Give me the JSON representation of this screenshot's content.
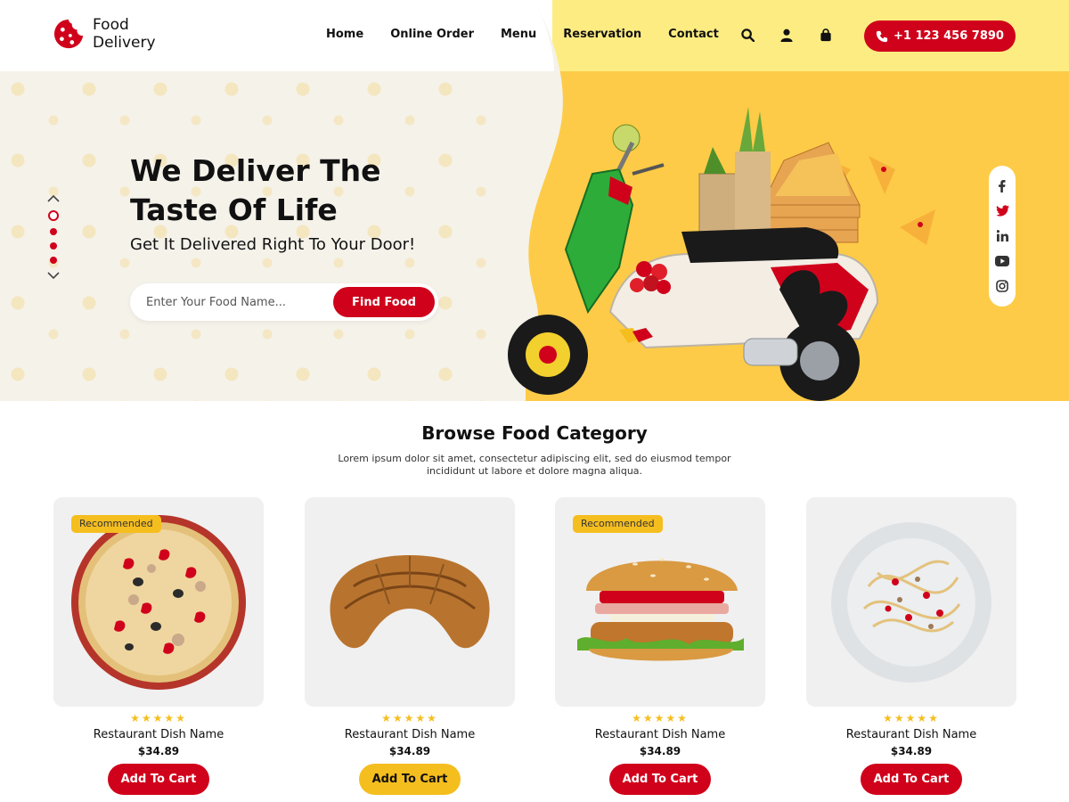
{
  "brand": {
    "line1": "Food",
    "line2": "Delivery",
    "accent": "#d0021b"
  },
  "nav": {
    "items": [
      "Home",
      "Online Order",
      "Menu",
      "Reservation",
      "Contact"
    ]
  },
  "header_icons": [
    "search-icon",
    "user-icon",
    "shopping-bag-icon"
  ],
  "phone": {
    "label": "+1 123 456 7890"
  },
  "hero": {
    "title_line1": "We Deliver The",
    "title_line2": "Taste Of Life",
    "subtitle": "Get It Delivered Right To Your Door!",
    "search_placeholder": "Enter Your Food Name...",
    "find_button": "Find Food",
    "slides": 4,
    "active_slide": 1
  },
  "social": [
    "facebook-icon",
    "twitter-icon",
    "linkedin-icon",
    "youtube-icon",
    "instagram-icon"
  ],
  "category": {
    "title": "Browse Food Category",
    "description": "Lorem ipsum dolor sit amet, consectetur adipiscing elit, sed do eiusmod tempor incididunt ut labore et dolore magna aliqua.",
    "cards": [
      {
        "food": "pizza",
        "badge": "Recommended",
        "rating": 5,
        "name": "Restaurant Dish Name",
        "price": "$34.89",
        "button": "Add To Cart",
        "button_style": "red"
      },
      {
        "food": "croissant",
        "badge": "",
        "rating": 5,
        "name": "Restaurant Dish Name",
        "price": "$34.89",
        "button": "Add To Cart",
        "button_style": "yellow"
      },
      {
        "food": "burger",
        "badge": "Recommended",
        "rating": 5,
        "name": "Restaurant Dish Name",
        "price": "$34.89",
        "button": "Add To Cart",
        "button_style": "red"
      },
      {
        "food": "pasta",
        "badge": "",
        "rating": 5,
        "name": "Restaurant Dish Name",
        "price": "$34.89",
        "button": "Add To Cart",
        "button_style": "red"
      }
    ]
  },
  "colors": {
    "red": "#d0021b",
    "yellow": "#fdcb47",
    "light_yellow": "#fdec82",
    "star": "#f5be1f"
  }
}
